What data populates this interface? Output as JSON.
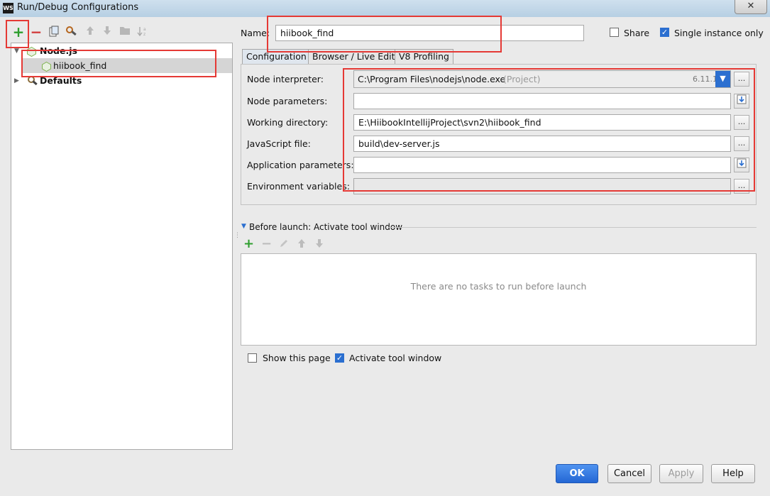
{
  "window": {
    "title": "Run/Debug Configurations",
    "logo": "WS",
    "close_glyph": "✕"
  },
  "left_toolbar": {
    "icons": [
      "add-icon",
      "remove-icon",
      "copy-icon",
      "edit-defaults-icon",
      "move-up-icon",
      "move-down-icon",
      "folder-icon",
      "sort-icon"
    ]
  },
  "tree": {
    "groups": [
      {
        "label": "Node.js",
        "children": [
          "hiibook_find"
        ]
      },
      {
        "label": "Defaults"
      }
    ]
  },
  "header": {
    "name_label": "Name:",
    "name_value": "hiibook_find",
    "share_label": "Share",
    "share_checked": false,
    "single_instance_label": "Single instance only",
    "single_instance_checked": true
  },
  "tabs": [
    "Configuration",
    "Browser / Live Edit",
    "V8 Profiling"
  ],
  "active_tab": "Configuration",
  "config": {
    "node_interpreter_label": "Node interpreter:",
    "node_interpreter_value": "C:\\Program Files\\nodejs\\node.exe",
    "node_interpreter_scope": "(Project)",
    "node_version": "6.11.1",
    "node_parameters_label": "Node parameters:",
    "node_parameters_value": "",
    "working_directory_label": "Working directory:",
    "working_directory_value": "E:\\HiibookIntellijProject\\svn2\\hiibook_find",
    "js_file_label": "JavaScript file:",
    "js_file_value": "build\\dev-server.js",
    "app_parameters_label": "Application parameters:",
    "app_parameters_value": "",
    "env_variables_label": "Environment variables:",
    "env_variables_value": "",
    "browse_glyph": "...",
    "expand_glyph": "⤓"
  },
  "before_launch": {
    "title": "Before launch: Activate tool window",
    "empty_text": "There are no tasks to run before launch",
    "show_page_label": "Show this page",
    "show_page_checked": false,
    "activate_tool_window_label": "Activate tool window",
    "activate_tool_window_checked": true
  },
  "buttons": {
    "ok": "OK",
    "cancel": "Cancel",
    "apply": "Apply",
    "help": "Help"
  },
  "colors": {
    "accent": "#2b6fd0",
    "highlight_box": "#e53935",
    "add": "#2e9e2e",
    "remove": "#d23b3b"
  }
}
